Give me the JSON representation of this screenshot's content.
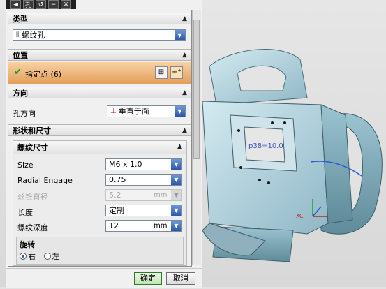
{
  "titlebar": {
    "icons": [
      "arrow-icon",
      "hole-icon",
      "undo-icon",
      "minus-icon",
      "close-icon"
    ],
    "title": "孔"
  },
  "sections": {
    "type": {
      "title": "类型",
      "selected": "螺纹孔"
    },
    "position": {
      "title": "位置",
      "item": "指定点 (6)"
    },
    "direction": {
      "title": "方向",
      "label": "孔方向",
      "selected": "垂直于面"
    },
    "shape": {
      "title": "形状和尺寸"
    }
  },
  "thread": {
    "title": "螺纹尺寸",
    "size": {
      "label": "Size",
      "value": "M6 x 1.0"
    },
    "radial": {
      "label": "Radial Engage",
      "value": "0.75"
    },
    "thread_dia": {
      "label": "丝锥直径",
      "value": "5.2",
      "unit": "mm"
    },
    "length": {
      "label": "长度",
      "value": "定制"
    },
    "depth": {
      "label": "螺纹深度",
      "value": "12",
      "unit": "mm"
    }
  },
  "rotation": {
    "title": "旋转",
    "right": "右",
    "left": "左",
    "selected": "right"
  },
  "buttons": {
    "ok": "确定",
    "cancel": "取消"
  },
  "viewport": {
    "annotation": "p38=10.0",
    "axis_label": "XC"
  },
  "colors": {
    "accent_orange": "#e49f5a",
    "check_green": "#1a9a1a",
    "dropdown_blue": "#2958ad"
  }
}
